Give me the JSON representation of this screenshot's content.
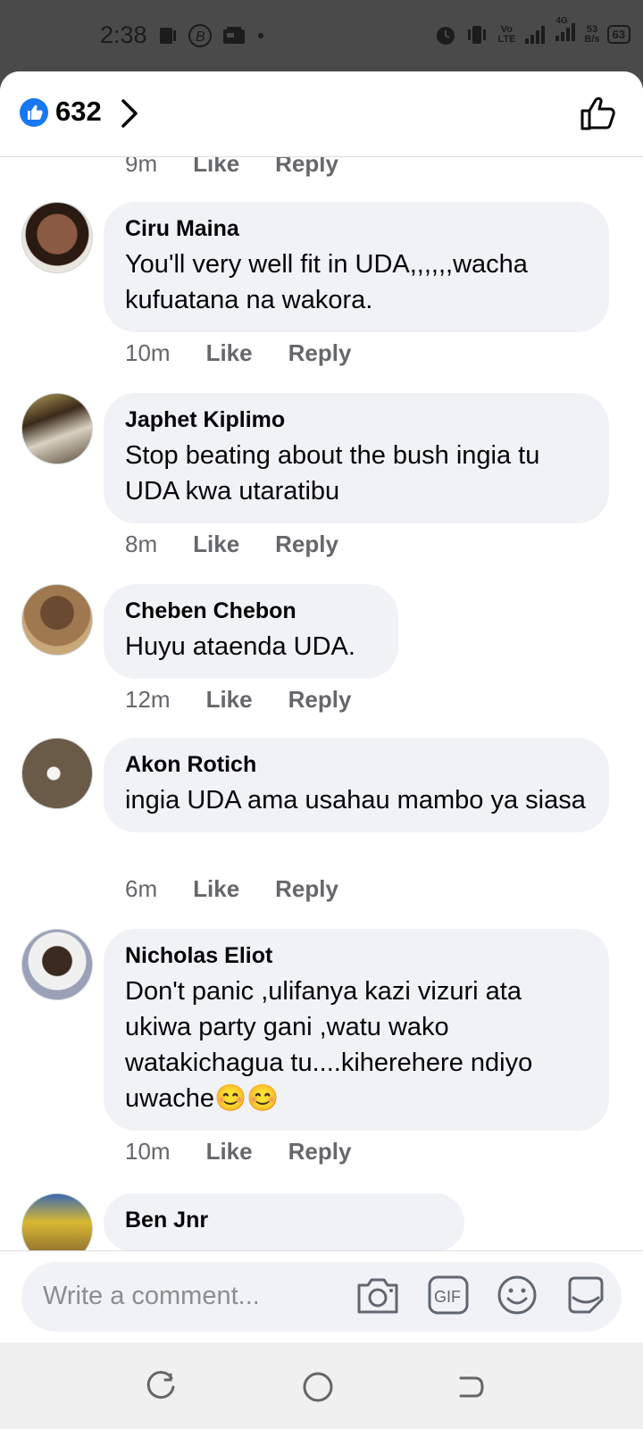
{
  "status_bar": {
    "time": "2:38",
    "left_icons": [
      "sim-icon",
      "b-icon",
      "radio-icon",
      "dot-icon"
    ],
    "right_icons": [
      "alarm-icon",
      "vibrate-icon",
      "volte-icon",
      "signal-icon",
      "signal-4g-icon"
    ],
    "volte_label": "Vo\nLTE",
    "network_label": "4G",
    "speed_value": "53",
    "speed_unit": "B/s",
    "battery": "63"
  },
  "header": {
    "reaction_count": "632"
  },
  "comments": [
    {
      "author": "",
      "text": "",
      "time": "9m",
      "like": "Like",
      "reply": "Reply"
    },
    {
      "author": "Ciru Maina",
      "text": "You'll very well fit in UDA,,,,,,wacha kufuatana na wakora.",
      "time": "10m",
      "like": "Like",
      "reply": "Reply",
      "avatar_color": "#6b4a3a"
    },
    {
      "author": "Japhet Kiplimo",
      "text": "Stop beating about the bush ingia tu UDA kwa utaratibu",
      "time": "8m",
      "like": "Like",
      "reply": "Reply",
      "avatar_color": "#5a4a2a"
    },
    {
      "author": "Cheben Chebon",
      "text": "Huyu ataenda UDA.",
      "time": "12m",
      "like": "Like",
      "reply": "Reply",
      "avatar_color": "#8a5a3a"
    },
    {
      "author": "Akon Rotich",
      "text": "ingia UDA ama usahau mambo ya siasa",
      "time": "6m",
      "like": "Like",
      "reply": "Reply",
      "avatar_color": "#6a5a4a"
    },
    {
      "author": "Nicholas Eliot",
      "text": "Don't panic ,ulifanya kazi vizuri ata ukiwa party gani ,watu wako watakichagua tu....kiherehere ndiyo uwache😊😊",
      "time": "10m",
      "like": "Like",
      "reply": "Reply",
      "avatar_color": "#7a6a8a"
    },
    {
      "author": "Ben Jnr",
      "text": "",
      "time": "",
      "like": "",
      "reply": "",
      "avatar_color": "#c8a22a"
    }
  ],
  "composer": {
    "placeholder": "Write a comment...",
    "icons": [
      "camera-icon",
      "gif-icon",
      "emoji-icon",
      "sticker-icon"
    ],
    "gif_label": "GIF"
  },
  "colors": {
    "accent": "#1877f2",
    "bubble": "#f0f2f5",
    "meta": "#65676b"
  }
}
